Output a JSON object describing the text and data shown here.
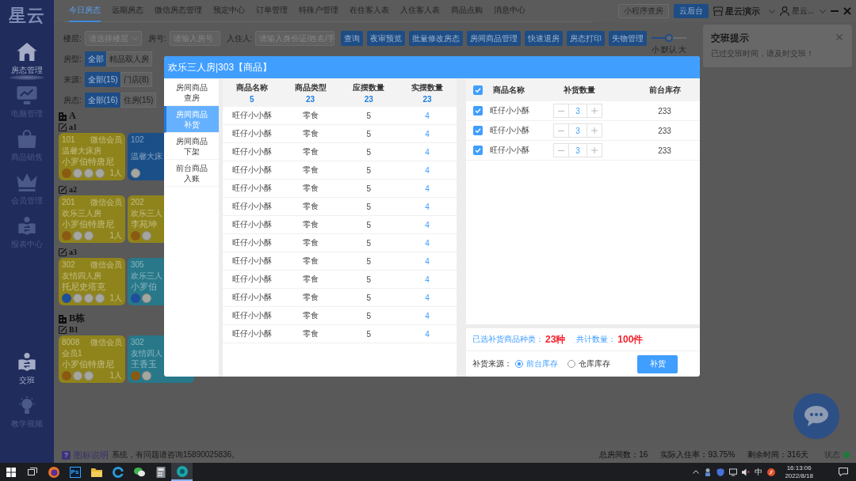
{
  "sidebar": {
    "logo": "星云",
    "items": [
      {
        "label": "房态管理",
        "selected": true
      },
      {
        "label": "电脑管理",
        "selected": false
      },
      {
        "label": "商品销售",
        "selected": false
      },
      {
        "label": "会员管理",
        "selected": false
      },
      {
        "label": "报表中心",
        "selected": false
      }
    ],
    "bottom_items": [
      {
        "label": "交班",
        "highlighted": true
      },
      {
        "label": "教学视频",
        "highlighted": false
      }
    ]
  },
  "top_tabs": [
    {
      "label": "今日房态",
      "selected": true
    },
    {
      "label": "远期房态",
      "selected": false
    },
    {
      "label": "微信房态管理",
      "selected": false
    },
    {
      "label": "预定中心",
      "selected": false
    },
    {
      "label": "订单管理",
      "selected": false
    },
    {
      "label": "特殊户管理",
      "selected": false
    },
    {
      "label": "在住客人表",
      "selected": false
    },
    {
      "label": "入住客人表",
      "selected": false
    },
    {
      "label": "商品点购",
      "selected": false
    },
    {
      "label": "消息中心",
      "selected": false
    }
  ],
  "header_actions": {
    "buttons": [
      {
        "label": "小程序查房",
        "primary": false
      },
      {
        "label": "云后台",
        "primary": true
      }
    ],
    "store": "星云演示",
    "user": "星云..."
  },
  "filters": {
    "fields": [
      {
        "label": "楼层:",
        "placeholder": "请选择楼层",
        "kind": "select"
      },
      {
        "label": "房号:",
        "placeholder": "请输入房号",
        "kind": "input"
      },
      {
        "label": "入住人:",
        "placeholder": "请输入身份证/姓名/手",
        "kind": "input"
      }
    ],
    "buttons": [
      "查询",
      "夜审预览",
      "批量修改房态",
      "房间商品管理",
      "快速退房",
      "房态打印",
      "失物管理"
    ],
    "size_slider": {
      "level": 0.5,
      "labels": [
        "小",
        "默认",
        "大"
      ]
    },
    "groups": [
      {
        "label": "房型:",
        "options": [
          {
            "label": "全部",
            "selected": true
          },
          {
            "label": "精品双人房",
            "selected": false
          }
        ]
      },
      {
        "label": "来源:",
        "options": [
          {
            "label": "全部(15)",
            "selected": true
          },
          {
            "label": "门店(8)",
            "selected": false
          }
        ]
      },
      {
        "label": "房态:",
        "options": [
          {
            "label": "全部(16)",
            "selected": true
          },
          {
            "label": "住房(15)",
            "selected": false
          }
        ]
      }
    ]
  },
  "buildings": [
    {
      "name": "A",
      "floors": [
        {
          "name": "a1",
          "rooms": [
            {
              "number": "101",
              "type": "温馨大床房",
              "guest": "小罗伯特唐尼",
              "member": "微信会员",
              "count": "1人",
              "color": "#8f841c",
              "tags": [
                {
                  "kind": "badge",
                  "color": "#8a5a12"
                },
                {
                  "kind": "circle"
                },
                {
                  "kind": "circle"
                },
                {
                  "kind": "circle"
                }
              ]
            },
            {
              "number": "102",
              "type": "温馨大床",
              "color": "#1b4f88",
              "tags": [
                {
                  "kind": "circle"
                }
              ]
            }
          ]
        },
        {
          "name": "a2",
          "rooms": [
            {
              "number": "201",
              "type": "欢乐三人房",
              "guest": "小罗伯特唐尼",
              "member": "微信会员",
              "count": "1人",
              "color": "#8f841c",
              "tags": [
                {
                  "kind": "badge",
                  "color": "#8a5a12"
                },
                {
                  "kind": "circle"
                },
                {
                  "kind": "circle"
                }
              ]
            },
            {
              "number": "202",
              "type": "欢乐三人",
              "guest": "李苑坤",
              "color": "#8f841c",
              "tags": [
                {
                  "kind": "badge",
                  "color": "#8a5a12"
                },
                {
                  "kind": "circle"
                }
              ]
            }
          ]
        },
        {
          "name": "a3",
          "rooms": [
            {
              "number": "302",
              "type": "友情四人房",
              "guest": "托尼史塔克",
              "member": "微信会员",
              "count": "1人",
              "color": "#8f841c",
              "tags": [
                {
                  "kind": "badge",
                  "color": "#1f4f9a"
                },
                {
                  "kind": "circle"
                },
                {
                  "kind": "circle"
                },
                {
                  "kind": "circle"
                }
              ]
            },
            {
              "number": "305",
              "type": "欢乐三人",
              "guest": "小罗伯",
              "color": "#28788a",
              "tags": [
                {
                  "kind": "badge",
                  "color": "#1f4f9a"
                },
                {
                  "kind": "circle"
                }
              ]
            }
          ]
        }
      ]
    },
    {
      "name": "B栋",
      "floors": [
        {
          "name": "B1",
          "rooms": [
            {
              "number": "8008",
              "type": "会员1",
              "guest": "小罗伯特唐尼",
              "member": "微信会员",
              "count": "1人",
              "color": "#8f841c",
              "tags": [
                {
                  "kind": "badge",
                  "color": "#8a5a12"
                },
                {
                  "kind": "circle"
                },
                {
                  "kind": "circle"
                }
              ]
            },
            {
              "number": "302",
              "type": "友情四人",
              "guest": "王香玉",
              "color": "#28788a",
              "tags": [
                {
                  "kind": "badge",
                  "color": "#8a5a12"
                },
                {
                  "kind": "circle"
                }
              ]
            }
          ]
        }
      ]
    }
  ],
  "modal": {
    "title": "欢乐三人房|303【商品】",
    "nav": [
      {
        "title": "房间商品",
        "subtitle": "查房",
        "selected": false
      },
      {
        "title": "房间商品",
        "subtitle": "补货",
        "selected": true
      },
      {
        "title": "房间商品",
        "subtitle": "下架",
        "selected": false
      },
      {
        "title": "前台商品",
        "subtitle": "入账",
        "selected": false
      }
    ],
    "goods_table": {
      "columns": [
        {
          "label": "商品名称",
          "total": "5"
        },
        {
          "label": "商品类型",
          "total": "23"
        },
        {
          "label": "应摆数量",
          "total": "23"
        },
        {
          "label": "实摆数量",
          "total": "23"
        }
      ],
      "rows": [
        [
          "旺仔小小酥",
          "零食",
          "5",
          "4"
        ],
        [
          "旺仔小小酥",
          "零食",
          "5",
          "4"
        ],
        [
          "旺仔小小酥",
          "零食",
          "5",
          "4"
        ],
        [
          "旺仔小小酥",
          "零食",
          "5",
          "4"
        ],
        [
          "旺仔小小酥",
          "零食",
          "5",
          "4"
        ],
        [
          "旺仔小小酥",
          "零食",
          "5",
          "4"
        ],
        [
          "旺仔小小酥",
          "零食",
          "5",
          "4"
        ],
        [
          "旺仔小小酥",
          "零食",
          "5",
          "4"
        ],
        [
          "旺仔小小酥",
          "零食",
          "5",
          "4"
        ],
        [
          "旺仔小小酥",
          "零食",
          "5",
          "4"
        ],
        [
          "旺仔小小酥",
          "零食",
          "5",
          "4"
        ],
        [
          "旺仔小小酥",
          "零食",
          "5",
          "4"
        ],
        [
          "旺仔小小酥",
          "零食",
          "5",
          "4"
        ]
      ]
    },
    "restock": {
      "all_checked": true,
      "columns": [
        "商品名称",
        "补货数量",
        "前台库存"
      ],
      "rows": [
        {
          "checked": true,
          "name": "旺仔小小酥",
          "quantity": "3",
          "stock": "233"
        },
        {
          "checked": true,
          "name": "旺仔小小酥",
          "quantity": "3",
          "stock": "233"
        },
        {
          "checked": true,
          "name": "旺仔小小酥",
          "quantity": "3",
          "stock": "233"
        }
      ],
      "summary": [
        {
          "label": "已选补货商品种类：",
          "value": "23种"
        },
        {
          "label": "共计数量：",
          "value": "100件"
        }
      ],
      "source": {
        "label": "补货来源：",
        "options": [
          {
            "label": "前台库存",
            "selected": true
          },
          {
            "label": "仓库库存",
            "selected": false
          }
        ]
      },
      "submit": "补货"
    }
  },
  "toast": {
    "title": "交班提示",
    "message": "已过交班时间，请及时交班！"
  },
  "status_bar": {
    "help_mark": "?",
    "help": "图标说明",
    "notice": "系统，有问题请咨询15890025836。",
    "stats": [
      "总房间数：16",
      "实际入住率：93.75%",
      "剩余时间：316天"
    ],
    "status_label": "状态",
    "online": true
  },
  "taskbar": {
    "apps": [
      {
        "selected": false
      },
      {
        "text": "Ps",
        "selected": false
      },
      {
        "selected": false
      },
      {
        "selected": false
      },
      {
        "selected": false
      },
      {
        "selected": false
      },
      {
        "selected": true
      }
    ],
    "ime": "中",
    "time": "16:13:06",
    "date": "2022/8/18"
  }
}
